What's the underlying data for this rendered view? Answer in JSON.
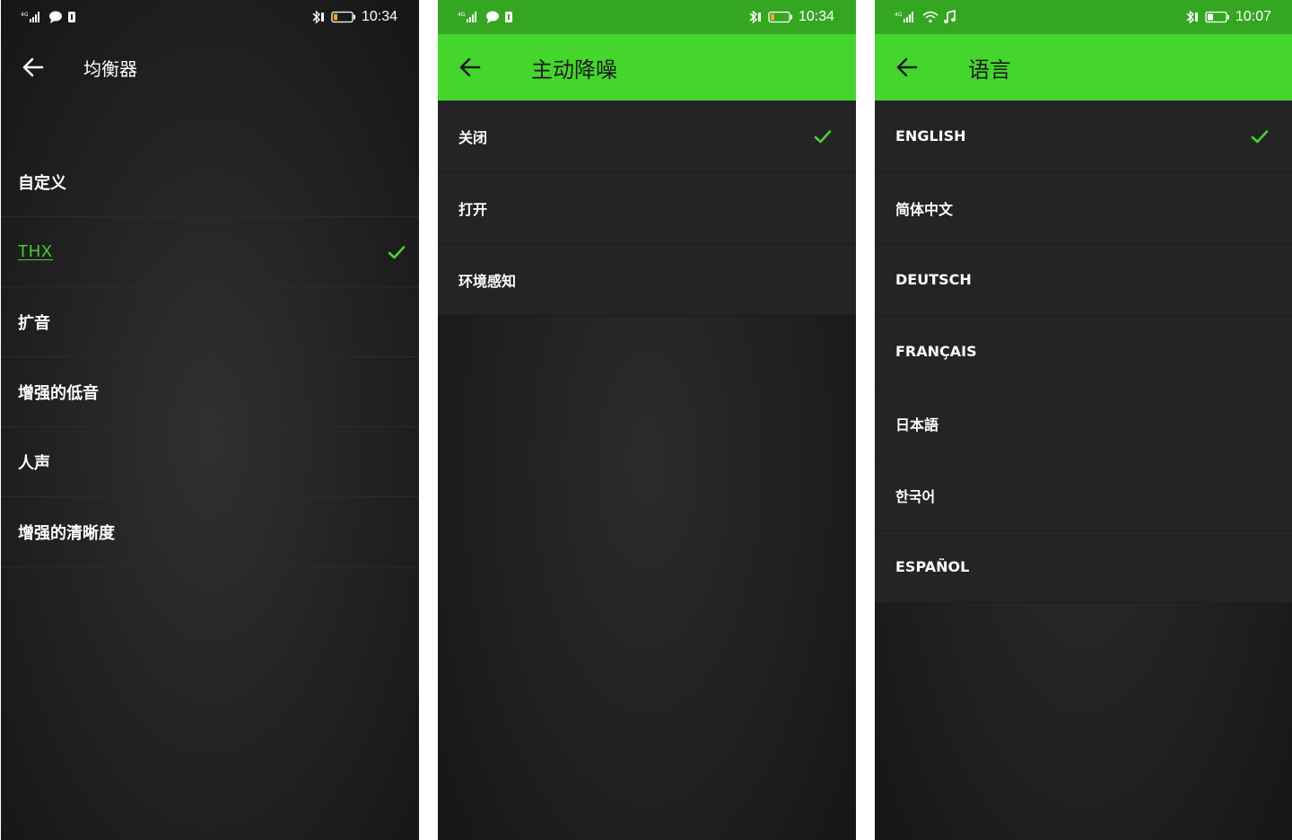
{
  "screens": [
    {
      "status": {
        "time": "10:34"
      },
      "header": {
        "title": "均衡器"
      },
      "items": [
        {
          "label": "自定义",
          "selected": false
        },
        {
          "label": "THX",
          "selected": true
        },
        {
          "label": "扩音",
          "selected": false
        },
        {
          "label": "增强的低音",
          "selected": false
        },
        {
          "label": "人声",
          "selected": false
        },
        {
          "label": "增强的清晰度",
          "selected": false
        }
      ]
    },
    {
      "status": {
        "time": "10:34"
      },
      "header": {
        "title": "主动降噪"
      },
      "items": [
        {
          "label": "关闭",
          "selected": true
        },
        {
          "label": "打开",
          "selected": false
        },
        {
          "label": "环境感知",
          "selected": false
        }
      ]
    },
    {
      "status": {
        "time": "10:07"
      },
      "header": {
        "title": "语言"
      },
      "items": [
        {
          "label": "ENGLISH",
          "selected": true
        },
        {
          "label": "简体中文",
          "selected": false
        },
        {
          "label": "DEUTSCH",
          "selected": false
        },
        {
          "label": "FRANÇAIS",
          "selected": false
        },
        {
          "label": "日本語",
          "selected": false
        },
        {
          "label": "한국어",
          "selected": false
        },
        {
          "label": "ESPAÑOL",
          "selected": false
        }
      ]
    }
  ],
  "colors": {
    "accent": "#44d62c",
    "status_green": "#35a622",
    "battery_low": "#f5a623"
  }
}
